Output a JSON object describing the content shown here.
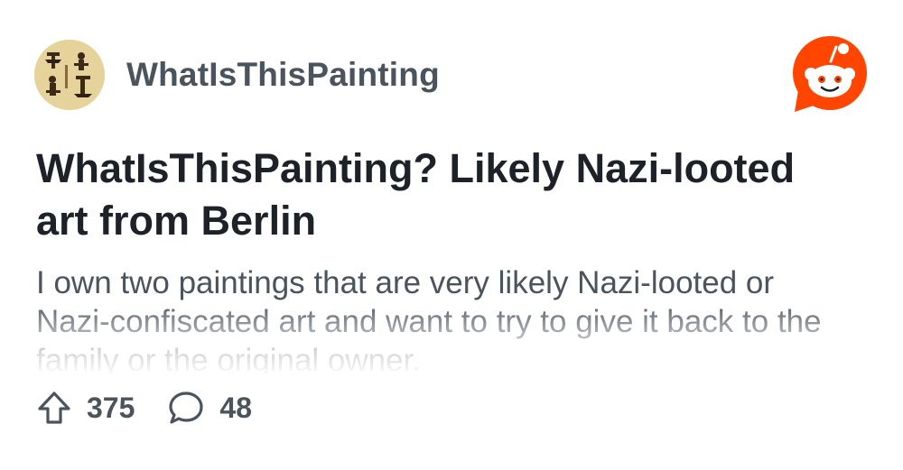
{
  "subreddit": {
    "name": "WhatIsThisPainting",
    "avatar_icon": "egyptian-hieroglyph-figures"
  },
  "brand": {
    "logo_icon": "reddit-snoo-icon",
    "color": "#ff4500"
  },
  "post": {
    "title": "WhatIsThisPainting? Likely Nazi-looted art from Berlin",
    "body": "I own two paintings that are very likely Nazi-looted or Nazi-confiscated art and want to try to give it back to the family or the original owner."
  },
  "stats": {
    "upvotes": "375",
    "comments": "48"
  },
  "colors": {
    "title": "#1c2228",
    "secondary_text": "#4a545c"
  }
}
